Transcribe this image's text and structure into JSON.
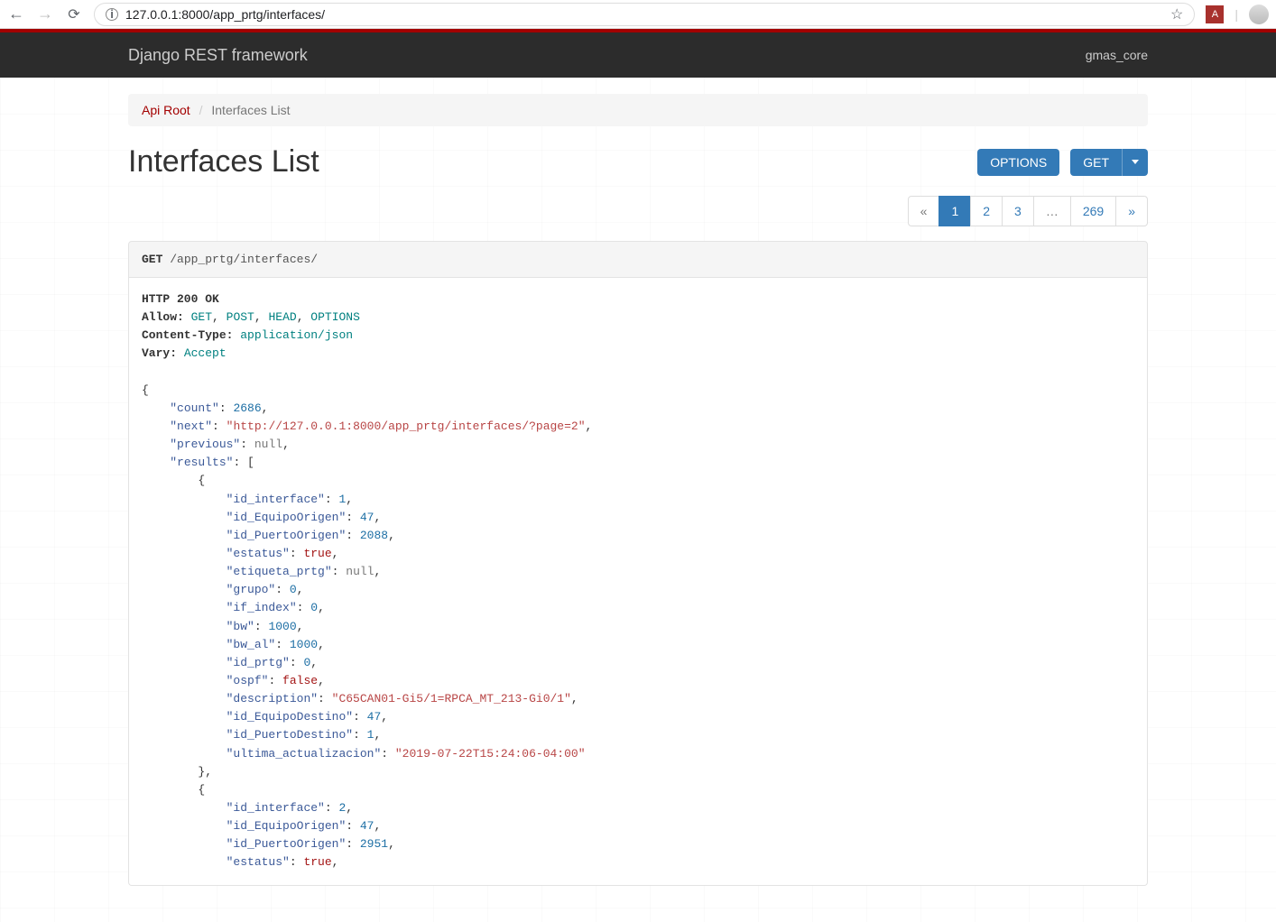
{
  "browser": {
    "url": "127.0.0.1:8000/app_prtg/interfaces/",
    "ext_label": "A"
  },
  "navbar": {
    "brand": "Django REST framework",
    "user": "gmas_core"
  },
  "breadcrumb": {
    "root_label": "Api Root",
    "current": "Interfaces List"
  },
  "page": {
    "title": "Interfaces List"
  },
  "buttons": {
    "options": "OPTIONS",
    "get": "GET"
  },
  "pagination": {
    "prev": "«",
    "pages": [
      "1",
      "2",
      "3",
      "…",
      "269"
    ],
    "active": "1",
    "next": "»"
  },
  "request": {
    "method": "GET",
    "path": "/app_prtg/interfaces/"
  },
  "response": {
    "status": "HTTP 200 OK",
    "headers": {
      "allow_label": "Allow:",
      "allow_values": [
        "GET",
        "POST",
        "HEAD",
        "OPTIONS"
      ],
      "content_type_label": "Content-Type:",
      "content_type": "application/json",
      "vary_label": "Vary:",
      "vary": "Accept"
    },
    "body": {
      "count": 2686,
      "next": "http://127.0.0.1:8000/app_prtg/interfaces/?page=2",
      "previous": null,
      "results": [
        {
          "id_interface": 1,
          "id_EquipoOrigen": 47,
          "id_PuertoOrigen": 2088,
          "estatus": true,
          "etiqueta_prtg": null,
          "grupo": 0,
          "if_index": 0,
          "bw": 1000,
          "bw_al": 1000,
          "id_prtg": 0,
          "ospf": false,
          "description": "C65CAN01-Gi5/1=RPCA_MT_213-Gi0/1",
          "id_EquipoDestino": 47,
          "id_PuertoDestino": 1,
          "ultima_actualizacion": "2019-07-22T15:24:06-04:00"
        },
        {
          "id_interface": 2,
          "id_EquipoOrigen": 47,
          "id_PuertoOrigen": 2951,
          "estatus": true
        }
      ]
    }
  }
}
